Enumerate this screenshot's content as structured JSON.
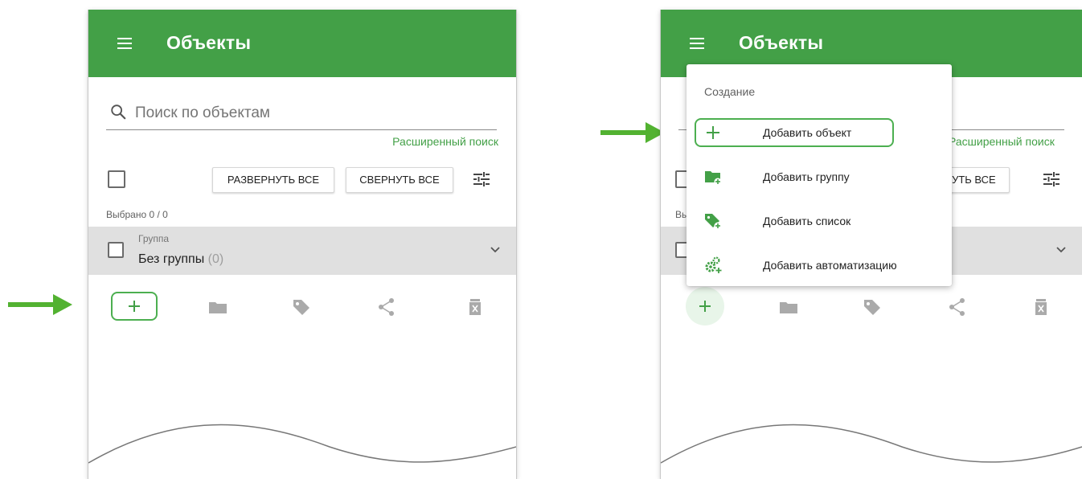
{
  "colors": {
    "primary": "#43a047",
    "accent_arrow": "#52b231",
    "group_bg": "#e0e0e0"
  },
  "header": {
    "title": "Объекты",
    "menu_icon": "hamburger-icon"
  },
  "search": {
    "placeholder": "Поиск по объектам",
    "advanced_label": "Расширенный поиск",
    "right_advanced_label": "Расширенный поиск"
  },
  "actions": {
    "expand_all": "Развернуть все",
    "collapse_all": "Свернуть все",
    "collapse_all_partial": "рнуть все"
  },
  "selection": {
    "label": "Выбрано 0 / 0",
    "partial_label": "Вы"
  },
  "group": {
    "caption": "Группа",
    "name": "Без группы",
    "count": "(0)"
  },
  "toolbar": {
    "icons": [
      "plus-icon",
      "folder-icon",
      "tag-icon",
      "share-icon",
      "delete-icon"
    ]
  },
  "create_menu": {
    "heading": "Создание",
    "items": [
      {
        "label": "Добавить объект",
        "icon": "plus-icon"
      },
      {
        "label": "Добавить группу",
        "icon": "folder-add-icon"
      },
      {
        "label": "Добавить список",
        "icon": "tag-add-icon"
      },
      {
        "label": "Добавить автоматизацию",
        "icon": "gears-add-icon"
      }
    ]
  }
}
